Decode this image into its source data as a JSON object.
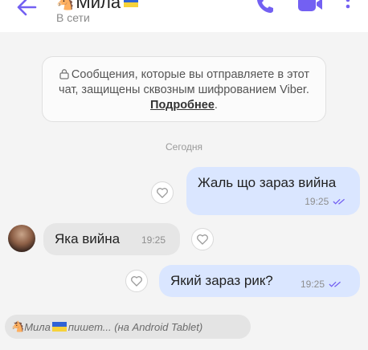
{
  "header": {
    "contact_name": "Мила",
    "status": "В сети"
  },
  "chat": {
    "encryption_notice": {
      "text": "Сообщения, которые вы отправляете в этот чат, защищены сквозным шифрованием Viber.",
      "link": "Подробнее",
      "suffix": "."
    },
    "date_label": "Сегодня",
    "messages": [
      {
        "direction": "out",
        "text": "Жаль що зараз вийна",
        "time": "19:25"
      },
      {
        "direction": "in",
        "text": "Яка вийна",
        "time": "19:25"
      },
      {
        "direction": "out",
        "text": "Який зараз рик?",
        "time": "19:25"
      }
    ],
    "typing": {
      "name": "Мила",
      "text": "пишет... (на Android Tablet)"
    }
  },
  "colors": {
    "accent": "#7360f2",
    "outgoing_bubble": "#dae6ff",
    "incoming_bubble": "#e6e6e6"
  },
  "icons": [
    "back-arrow-icon",
    "call-icon",
    "video-call-icon",
    "more-menu-icon",
    "lock-icon",
    "heart-icon",
    "read-ticks-icon"
  ]
}
